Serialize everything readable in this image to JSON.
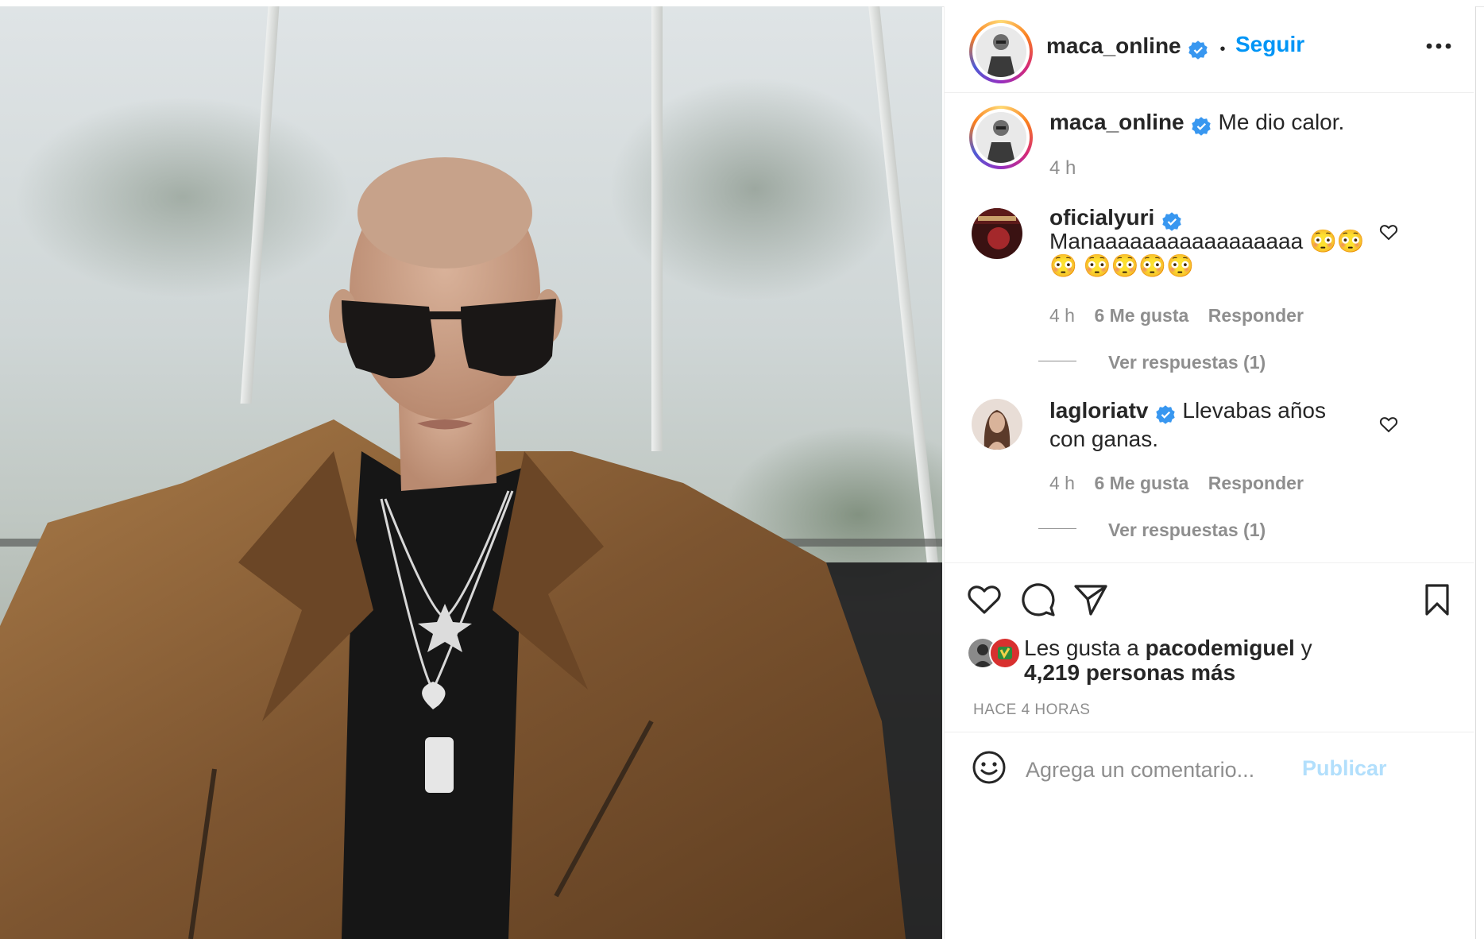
{
  "post": {
    "username": "maca_online",
    "follow_label": "Seguir",
    "dot": "•",
    "caption": "Me dio calor.",
    "caption_time": "4 h"
  },
  "comments": [
    {
      "username": "oficialyuri",
      "text": "Manaaaaaaaaaaaaaaaaa 😳😳😳 😳😳😳😳",
      "time": "4 h",
      "likes": "6 Me gusta",
      "reply": "Responder",
      "view_replies": "Ver respuestas (1)"
    },
    {
      "username": "lagloriatv",
      "text": "Llevabas años con ganas.",
      "time": "4 h",
      "likes": "6 Me gusta",
      "reply": "Responder",
      "view_replies": "Ver respuestas (1)"
    }
  ],
  "likes": {
    "prefix": "Les gusta a",
    "user": "pacodemiguel",
    "conj": "y",
    "others": "4,219 personas más"
  },
  "timestamp": "HACE 4 HORAS",
  "comment_box": {
    "placeholder": "Agrega un comentario...",
    "publish": "Publicar"
  },
  "icons": {
    "verified": "verified-badge-icon",
    "more": "more-options-icon",
    "like": "heart-icon",
    "comment": "comment-icon",
    "share": "paper-plane-icon",
    "save": "bookmark-icon",
    "emoji": "smiley-icon"
  },
  "colors": {
    "link": "#0095f6",
    "verified": "#3897f0",
    "muted": "#8e8e8e",
    "publish_disabled": "#b2dffc"
  }
}
